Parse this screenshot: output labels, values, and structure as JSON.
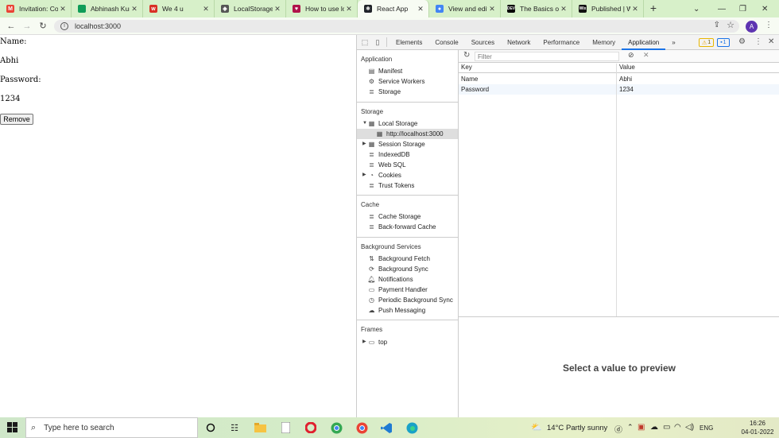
{
  "browser": {
    "tabs": [
      {
        "title": "Invitation: Co",
        "icon": "gmail-icon",
        "color": "#ea4335",
        "glyph": "M"
      },
      {
        "title": "Abhinash Kum",
        "icon": "sheets-icon",
        "color": "#0f9d58",
        "glyph": ""
      },
      {
        "title": "We 4 u",
        "icon": "wp-icon",
        "color": "#d93025",
        "glyph": "w"
      },
      {
        "title": "LocalStorage c",
        "icon": "diamond-icon",
        "color": "#555",
        "glyph": "◈"
      },
      {
        "title": "How to use lo",
        "icon": "heart-icon",
        "color": "#b0134a",
        "glyph": "♥"
      },
      {
        "title": "React App",
        "icon": "react-icon",
        "color": "#20232a",
        "glyph": "⚛",
        "active": true
      },
      {
        "title": "View and edit",
        "icon": "chrome-icon",
        "color": "#4285f4",
        "glyph": "●"
      },
      {
        "title": "The Basics of",
        "icon": "dev-icon",
        "color": "#000",
        "glyph": "DEV"
      },
      {
        "title": "Published | W",
        "icon": "wix-icon",
        "color": "#111",
        "glyph": "Wix"
      }
    ],
    "url": "localhost:3000"
  },
  "page": {
    "name_label": "Name:",
    "name_value": "Abhi",
    "password_label": "Password:",
    "password_value": "1234",
    "remove_button": "Remove"
  },
  "devtools": {
    "tabs": [
      "Elements",
      "Console",
      "Sources",
      "Network",
      "Performance",
      "Memory",
      "Application"
    ],
    "active_tab": "Application",
    "more": "»",
    "warnings": "1",
    "messages": "1",
    "sidebar": {
      "application_title": "Application",
      "application_items": [
        "Manifest",
        "Service Workers",
        "Storage"
      ],
      "storage_title": "Storage",
      "local_storage": "Local Storage",
      "local_storage_origin": "http://localhost:3000",
      "storage_items": [
        "Session Storage",
        "IndexedDB",
        "Web SQL",
        "Cookies",
        "Trust Tokens"
      ],
      "cache_title": "Cache",
      "cache_items": [
        "Cache Storage",
        "Back-forward Cache"
      ],
      "bg_title": "Background Services",
      "bg_items": [
        "Background Fetch",
        "Background Sync",
        "Notifications",
        "Payment Handler",
        "Periodic Background Sync",
        "Push Messaging"
      ],
      "frames_title": "Frames",
      "frames_top": "top"
    },
    "filter_placeholder": "Filter",
    "table": {
      "key_header": "Key",
      "value_header": "Value",
      "rows": [
        {
          "key": "Name",
          "value": "Abhi"
        },
        {
          "key": "Password",
          "value": "1234"
        }
      ]
    },
    "preview_text": "Select a value to preview"
  },
  "taskbar": {
    "search_placeholder": "Type here to search",
    "weather_temp": "14°C",
    "weather_desc": "Partly sunny",
    "language": "ENG",
    "time": "16:26",
    "date": "04-01-2022"
  },
  "colors": {
    "tabstrip": "#d7f0c9",
    "accent": "#1a73e8",
    "selected_row": "#dedede"
  }
}
